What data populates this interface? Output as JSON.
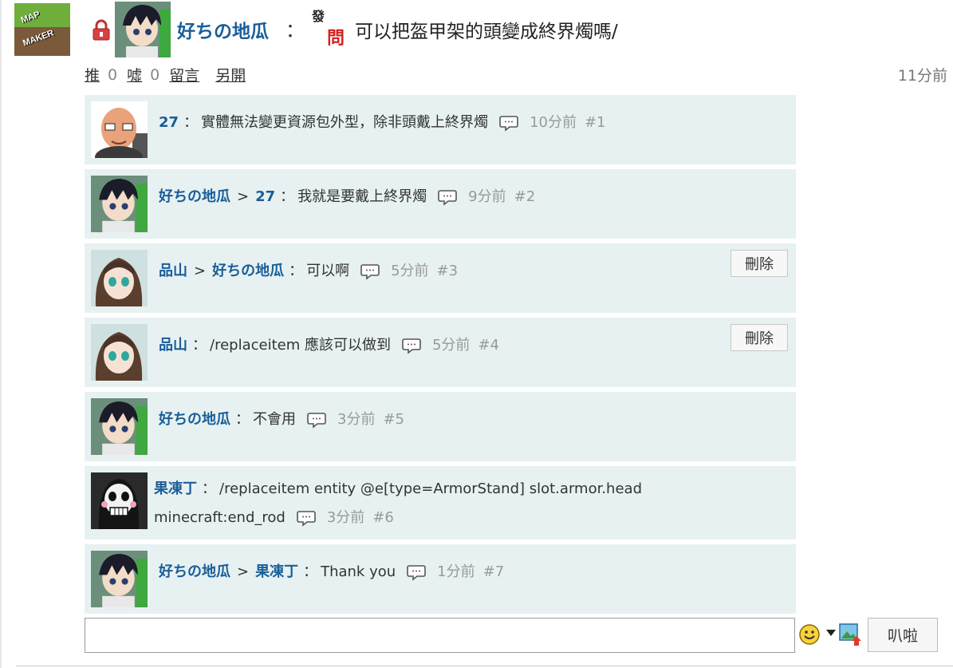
{
  "board": {
    "logo_text_1": "MAP",
    "logo_text_2": "MAKER"
  },
  "post": {
    "author": "好ちの地瓜",
    "colon": "：",
    "tag_top": "發",
    "tag_bottom": "問",
    "title": "可以把盔甲架的頭變成終界燭嗎/",
    "time": "11分前"
  },
  "actions": {
    "push_label": "推",
    "push_count": "0",
    "boo_label": "噓",
    "boo_count": "0",
    "comment_label": "留言",
    "open_label": "另開"
  },
  "comments": [
    {
      "name": "27",
      "reply_to": "",
      "text": "實體無法變更資源包外型，除非頭戴上終界燭",
      "time": "10分前",
      "floor": "#1",
      "delete": ""
    },
    {
      "name": "好ちの地瓜",
      "reply_to": "27",
      "text": "我就是要戴上終界燭",
      "time": "9分前",
      "floor": "#2",
      "delete": ""
    },
    {
      "name": "品山",
      "reply_to": "好ちの地瓜",
      "text": "可以啊",
      "time": "5分前",
      "floor": "#3",
      "delete": "刪除"
    },
    {
      "name": "品山",
      "reply_to": "",
      "text": "/replaceitem 應該可以做到",
      "time": "5分前",
      "floor": "#4",
      "delete": "刪除"
    },
    {
      "name": "好ちの地瓜",
      "reply_to": "",
      "text": "不會用",
      "time": "3分前",
      "floor": "#5",
      "delete": ""
    },
    {
      "name": "果凍丁",
      "reply_to": "",
      "text": "/replaceitem entity @e[type=ArmorStand] slot.armor.head",
      "text2": "minecraft:end_rod",
      "time": "3分前",
      "floor": "#6",
      "delete": ""
    },
    {
      "name": "好ちの地瓜",
      "reply_to": "果凍丁",
      "text": "Thank you",
      "time": "1分前",
      "floor": "#7",
      "delete": ""
    }
  ],
  "separators": {
    "arrow": ">",
    "colon": "："
  },
  "reply": {
    "placeholder": "",
    "submit_label": "叭啦"
  },
  "icons": {
    "lock": "lock-icon",
    "reply": "speech-bubble-icon",
    "emoji": "smiley-icon",
    "image": "image-upload-icon",
    "dropdown": "caret-down-icon"
  },
  "colors": {
    "link": "#1a5e99",
    "comment_bg": "#e7f1f1",
    "meta": "#999999"
  }
}
